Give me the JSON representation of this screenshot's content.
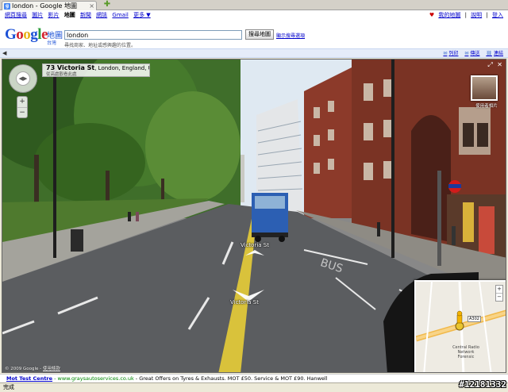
{
  "browser": {
    "tab_title": "london - Google 地圖",
    "tab_close": "×",
    "new_tab": "✚"
  },
  "gbar": {
    "left": [
      "網頁搜尋",
      "圖片",
      "影片",
      "地圖",
      "新聞",
      "網誌",
      "Gmail",
      "更多 ▼"
    ],
    "current": "地圖",
    "right": [
      "我的地圖",
      "說明",
      "登入"
    ],
    "heart": "♥"
  },
  "header": {
    "logo": "Google",
    "maps_label": "地圖",
    "region": "台灣",
    "search_value": "london",
    "search_hint": "尋找商家、地址或感興趣的位置。",
    "search_button": "搜尋地圖",
    "directions_link": "顯示搜尋選項"
  },
  "mapbar": {
    "arrow": "◀",
    "links": [
      {
        "icon": "✉",
        "label": "列印"
      },
      {
        "icon": "✉",
        "label": "傳送"
      },
      {
        "icon": "⛓",
        "label": "連結"
      }
    ]
  },
  "streetview": {
    "street": "73 Victoria St",
    "address_rest": ", London, England, United Kingdom",
    "address_sub": "從高處觀看此處",
    "thumb_label": "使用者相片",
    "road_label_near": "Victoria St",
    "road_label_far": "Victoria St",
    "copyright": "© 2009 Google",
    "terms": "使用條款",
    "nav_center": "◀▶",
    "zoom_in": "+",
    "zoom_out": "−",
    "top_icons": [
      "⤢",
      "✕"
    ]
  },
  "minimap": {
    "road_shield": "A302",
    "place": "Central Radio Network Forensic",
    "zoom_in": "+",
    "zoom_out": "−"
  },
  "ad": {
    "title": "Mot Test Centre",
    "url": " - www.graysautoservices.co.uk",
    "text": " - Great Offers on Tyres & Exhausts. MOT £50. Service & MOT £90. Hanwell"
  },
  "status": {
    "text": "完成"
  },
  "watermark": "#12181332",
  "colors": {
    "sky": "#dfe9f2",
    "road": "#5b5d60",
    "yellow_line": "#d9c23b",
    "brick": "#8c3a2a"
  }
}
